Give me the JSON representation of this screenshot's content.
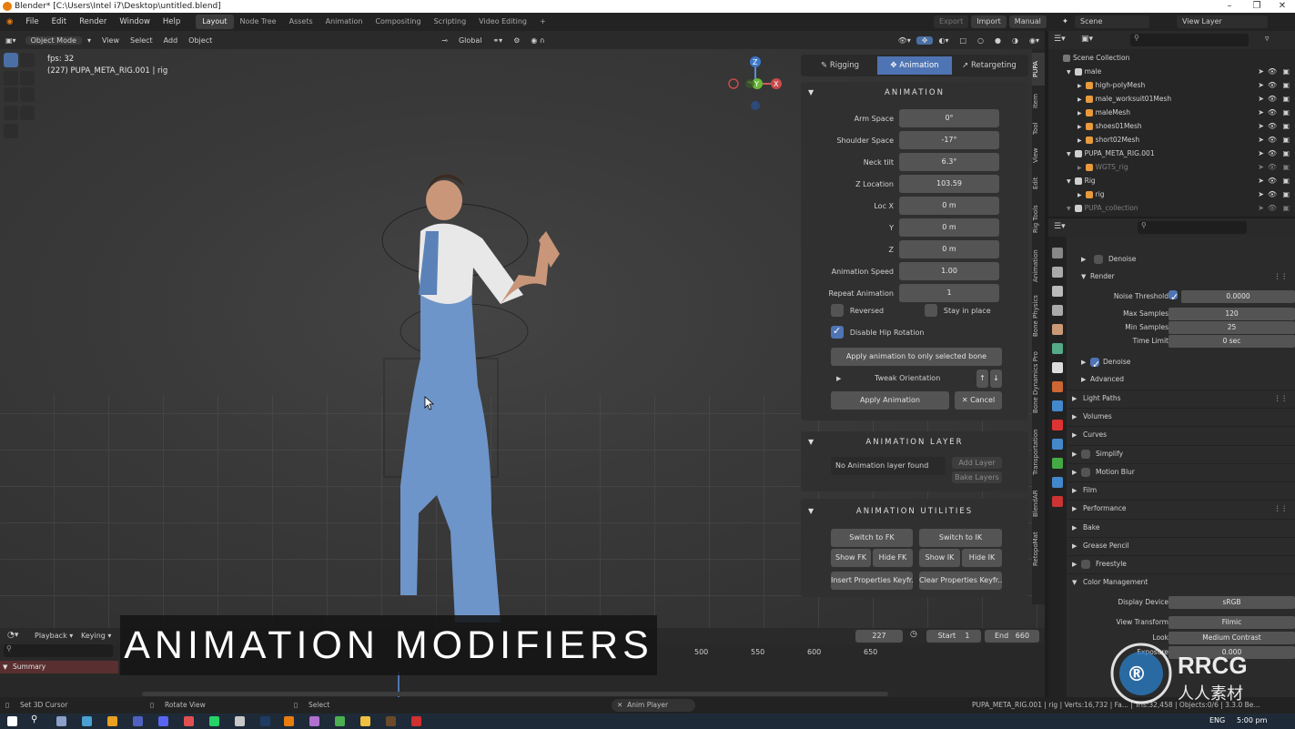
{
  "window": {
    "title": "Blender* [C:\\Users\\Intel i7\\Desktop\\untitled.blend]",
    "controls": [
      "–",
      "❐",
      "✕"
    ]
  },
  "menu": {
    "items": [
      "File",
      "Edit",
      "Render",
      "Window",
      "Help"
    ],
    "workspaces": [
      "Layout",
      "Node Tree",
      "Assets",
      "Animation",
      "Compositing",
      "Scripting",
      "Video Editing",
      "+"
    ],
    "active_workspace": "Layout",
    "export": "Export",
    "import": "Import",
    "manual": "Manual",
    "scene": "Scene",
    "view_layer": "View Layer"
  },
  "viewport_header": {
    "mode": "Object Mode",
    "items": [
      "View",
      "Select",
      "Add",
      "Object"
    ],
    "orientation": "Global"
  },
  "viewport": {
    "fps": "fps: 32",
    "object_info": "(227) PUPA_META_RIG.001 | rig",
    "axes": {
      "z": "Z",
      "y": "Y",
      "x": "X"
    }
  },
  "pupa": {
    "tabs": [
      "Rigging",
      "Animation",
      "Retargeting"
    ],
    "active_tab": "Animation",
    "animation": {
      "title": "ANIMATION",
      "props": [
        {
          "label": "Arm Space",
          "value": "0°"
        },
        {
          "label": "Shoulder Space",
          "value": "-17°"
        },
        {
          "label": "Neck tilt",
          "value": "6.3°"
        },
        {
          "label": "Z Location",
          "value": "103.59"
        },
        {
          "label": "Loc X",
          "value": "0 m"
        },
        {
          "label": "Y",
          "value": "0 m"
        },
        {
          "label": "Z",
          "value": "0 m"
        },
        {
          "label": "Animation Speed",
          "value": "1.00"
        },
        {
          "label": "Repeat Animation",
          "value": "1"
        }
      ],
      "reversed": "Reversed",
      "stay_in_place": "Stay in place",
      "disable_hip_rotation": "Disable Hip Rotation",
      "disable_hip_rotation_checked": true,
      "apply_selected_bone": "Apply animation to only selected bone",
      "tweak_orientation": "Tweak Orientation",
      "apply_animation": "Apply Animation",
      "cancel": "Cancel"
    },
    "layer": {
      "title": "ANIMATION LAYER",
      "status": "No Animation layer found",
      "add_layer": "Add Layer",
      "bake_layers": "Bake Layers"
    },
    "utilities": {
      "title": "ANIMATION UTILITIES",
      "switch_fk": "Switch to FK",
      "switch_ik": "Switch to IK",
      "show_fk": "Show FK",
      "hide_fk": "Hide FK",
      "show_ik": "Show IK",
      "hide_ik": "Hide IK",
      "insert_keyframes": "Insert Properties Keyfr...",
      "clear_keyframes": "Clear Properties Keyfr..."
    }
  },
  "side_tabs": [
    "PUPA",
    "Item",
    "Tool",
    "View",
    "Edit",
    "Rig Tools",
    "Animation",
    "Bone Physics",
    "Bone Dynamics Pro",
    "Transportation",
    "BlendAR",
    "RetopoMat"
  ],
  "outliner": {
    "root": "Scene Collection",
    "rows": [
      {
        "name": "male",
        "level": 1
      },
      {
        "name": "high-polyMesh",
        "level": 2
      },
      {
        "name": "male_worksuit01Mesh",
        "level": 2
      },
      {
        "name": "maleMesh",
        "level": 2
      },
      {
        "name": "shoes01Mesh",
        "level": 2
      },
      {
        "name": "short02Mesh",
        "level": 2
      },
      {
        "name": "PUPA_META_RIG.001",
        "level": 1
      },
      {
        "name": "WGTS_rig",
        "level": 2
      },
      {
        "name": "Rig",
        "level": 1
      },
      {
        "name": "rig",
        "level": 2
      },
      {
        "name": "PUPA_collection",
        "level": 1
      }
    ]
  },
  "properties": {
    "rows": [
      {
        "label": "Denoise",
        "type": "check"
      },
      {
        "label": "Render",
        "type": "subpanel"
      },
      {
        "label": "Noise Threshold",
        "value": "0.0000"
      },
      {
        "label": "Max Samples",
        "value": "120"
      },
      {
        "label": "Min Samples",
        "value": "25"
      },
      {
        "label": "Time Limit",
        "value": "0 sec"
      },
      {
        "label": "Denoise",
        "type": "subpanel-check"
      },
      {
        "label": "Advanced",
        "type": "subpanel"
      },
      {
        "label": "Light Paths",
        "type": "panel"
      },
      {
        "label": "Volumes",
        "type": "panel"
      },
      {
        "label": "Curves",
        "type": "panel"
      },
      {
        "label": "Simplify",
        "type": "panel-check"
      },
      {
        "label": "Motion Blur",
        "type": "panel-check"
      },
      {
        "label": "Film",
        "type": "panel"
      },
      {
        "label": "Performance",
        "type": "panel"
      },
      {
        "label": "Bake",
        "type": "panel"
      },
      {
        "label": "Grease Pencil",
        "type": "panel"
      },
      {
        "label": "Freestyle",
        "type": "panel-check"
      },
      {
        "label": "Color Management",
        "type": "panel"
      },
      {
        "label": "Display Device",
        "value": "sRGB"
      },
      {
        "label": "View Transform",
        "value": "Filmic"
      },
      {
        "label": "Look",
        "value": "Medium Contrast"
      },
      {
        "label": "Exposure",
        "value": "0.000"
      }
    ]
  },
  "timeline": {
    "playback": "Playback",
    "keying": "Keying",
    "current_frame": "227",
    "start_label": "Start",
    "start": "1",
    "end_label": "End",
    "end": "660",
    "ticks": [
      "500",
      "550",
      "600",
      "650"
    ],
    "summary": "Summary"
  },
  "caption": "ANIMATION MODIFIERS",
  "status": {
    "left1": "Set 3D Cursor",
    "left2": "Rotate View",
    "left3": "Select",
    "center": "Anim Player",
    "right": "PUPA_META_RIG.001 | rig | Verts:16,732 | Fa... | Tris:32,458 | Objects:0/6 | 3.3.0 Be..."
  },
  "taskbar": {
    "lang": "ENG",
    "time": "5:00 pm"
  },
  "watermark": {
    "brand": "RRCG",
    "sub": "人人素材"
  }
}
